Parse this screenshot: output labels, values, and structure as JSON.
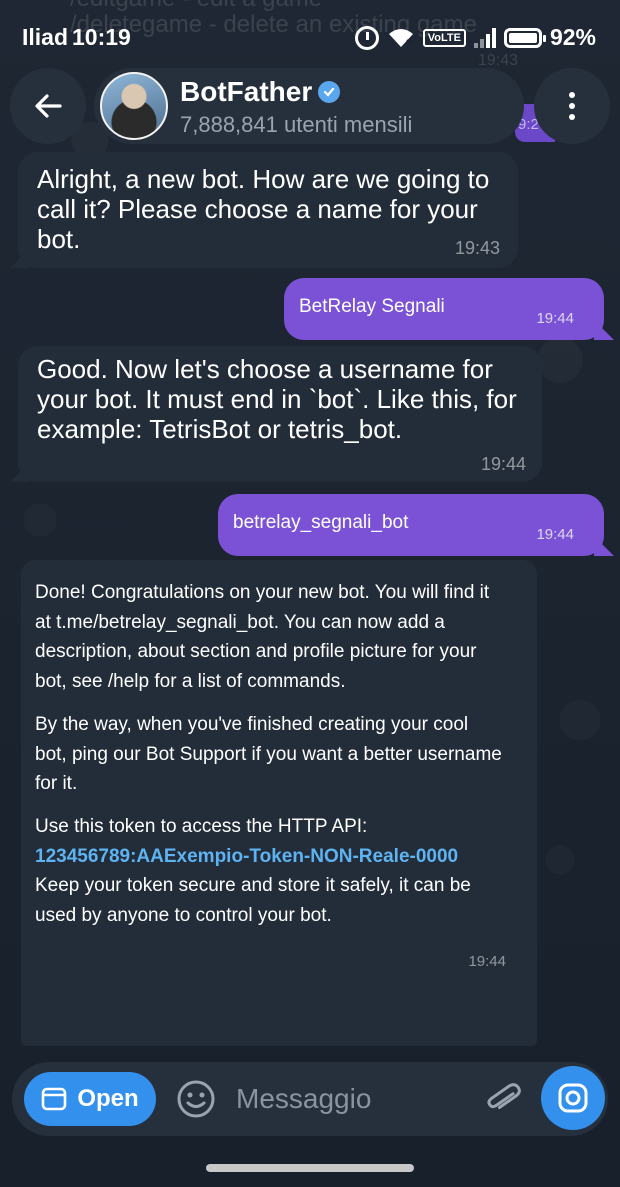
{
  "status_bar": {
    "carrier": "Iliad",
    "time": "10:19",
    "network_badge": "VoLTE",
    "battery": "92%"
  },
  "ghost_text": {
    "line1": "/editgame - edit a game",
    "line2": "/deletegame - delete an existing game",
    "time": "19:43"
  },
  "header": {
    "back_icon": "arrow-left-icon",
    "name": "BotFather",
    "subtitle": "7,888,841 utenti mensili",
    "menu_icon": "more-vertical-icon",
    "peek_time": "9:2"
  },
  "messages": [
    {
      "direction": "in",
      "text": "Alright, a new bot. How are we going to call it? Please choose a name for your bot.",
      "time": "19:43"
    },
    {
      "direction": "out",
      "text": "BetRelay Segnali",
      "time": "19:44"
    },
    {
      "direction": "in",
      "text": "Good. Now let's choose a username for your bot. It must end in `bot`. Like this, for example: TetrisBot or tetris_bot.",
      "time": "19:44"
    },
    {
      "direction": "out",
      "text": "betrelay_segnali_bot",
      "time": "19:44"
    },
    {
      "direction": "in",
      "p1": "Done! Congratulations on your new bot. You will find it at t.me/betrelay_segnali_bot. You can now add a description, about section and profile picture for your bot, see /help for a list of commands.",
      "p2": "By the way, when you've finished creating your cool bot, ping our Bot Support if you want a better username for it.",
      "p3_intro": "Use this token to access the HTTP API:",
      "token": "123456789:AAExempio-Token-NON-Reale-0000",
      "p3_outro": "Keep your token secure and store it safely, it can be used by anyone to control your bot.",
      "time": "19:44"
    }
  ],
  "input_bar": {
    "open_label": "Open",
    "placeholder": "Messaggio"
  },
  "colors": {
    "background": "#1b2430",
    "incoming_bubble": "#232d39",
    "outgoing_bubble": "#7b52d6",
    "accent": "#3390ec",
    "token_link": "#5eb3f2"
  }
}
